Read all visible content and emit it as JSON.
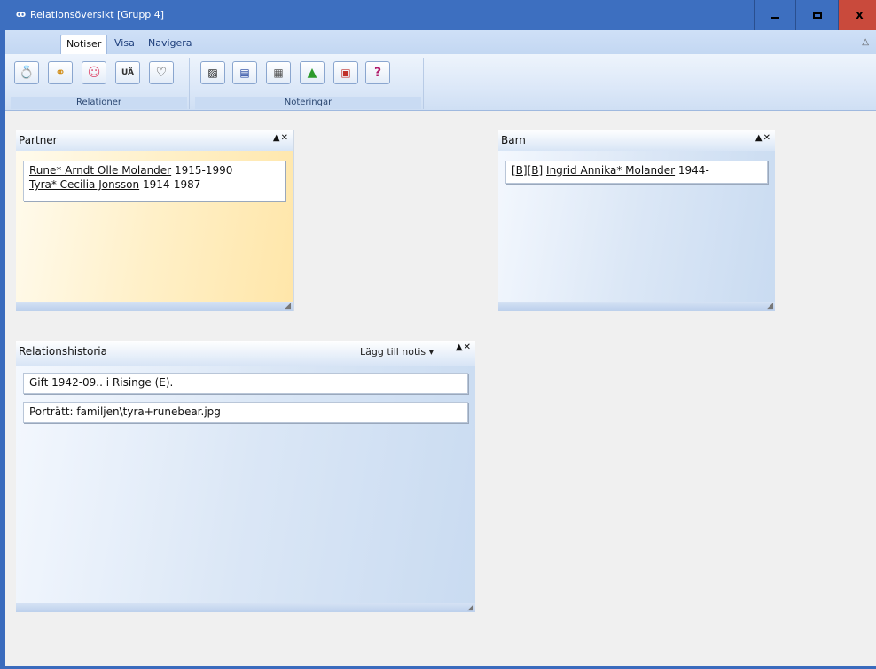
{
  "window": {
    "title": "Relationsöversikt [Grupp 4]"
  },
  "ribbon": {
    "tabs": [
      {
        "label": "Notiser",
        "active": true
      },
      {
        "label": "Visa",
        "active": false
      },
      {
        "label": "Navigera",
        "active": false
      }
    ],
    "groups": {
      "relationer": {
        "label": "Relationer"
      },
      "noteringar": {
        "label": "Noteringar"
      }
    },
    "ua_button_label": "UÄ"
  },
  "partner_panel": {
    "title": "Partner",
    "entries": [
      {
        "name": "Rune* Arndt Olle Molander",
        "years": "1915-1990"
      },
      {
        "name": "Tyra* Cecilia Jonsson",
        "years": "1914-1987"
      }
    ]
  },
  "barn_panel": {
    "title": "Barn",
    "entries": [
      {
        "prefix": "[B][B]",
        "name": "Ingrid Annika* Molander",
        "years": "1944-"
      }
    ]
  },
  "history_panel": {
    "title": "Relationshistoria",
    "add_note_label": "Lägg till notis",
    "entries": [
      "Gift 1942-09.. i Risinge (E).",
      "Porträtt: familjen\\tyra+runebear.jpg"
    ]
  },
  "colors": {
    "titlebar": "#3d6fc0",
    "close_button": "#c94a3c",
    "partner_panel_bg": "#fff0c8",
    "panel_bg": "#dbe7f6"
  }
}
